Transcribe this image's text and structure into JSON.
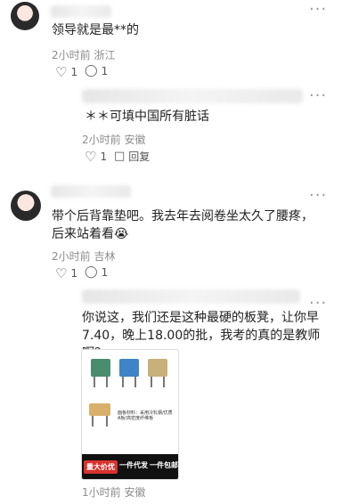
{
  "comments": [
    {
      "text": "领导就是最**的",
      "time": "2小时前",
      "location": "浙江",
      "likes": "1",
      "replies": "1"
    },
    {
      "text": "＊＊可填中国所有脏话",
      "time": "2小时前",
      "location": "安徽",
      "likes": "1",
      "reply_label": "回复"
    },
    {
      "text": "带个后背靠垫吧。我去年去阅卷坐太久了腰疼，后来站着看😭",
      "time": "2小时前",
      "location": "吉林",
      "likes": "1",
      "replies": "1"
    },
    {
      "text": "你说这，我们还是这种最硬的板凳，让你早7.40，晚上18.00的批，我考的真的是教师啊？",
      "time": "1小时前",
      "location": "安徽",
      "image": {
        "caption": "面板材料：采用冷轧钢/优质A板/高密度纤维板",
        "banner_left": "量大价优",
        "banner_mid": "一件代发",
        "banner_right": "一件包邮"
      }
    }
  ],
  "icons": {
    "more": "more-dots-icon",
    "like": "heart-icon",
    "reply": "comment-bubble-icon"
  }
}
